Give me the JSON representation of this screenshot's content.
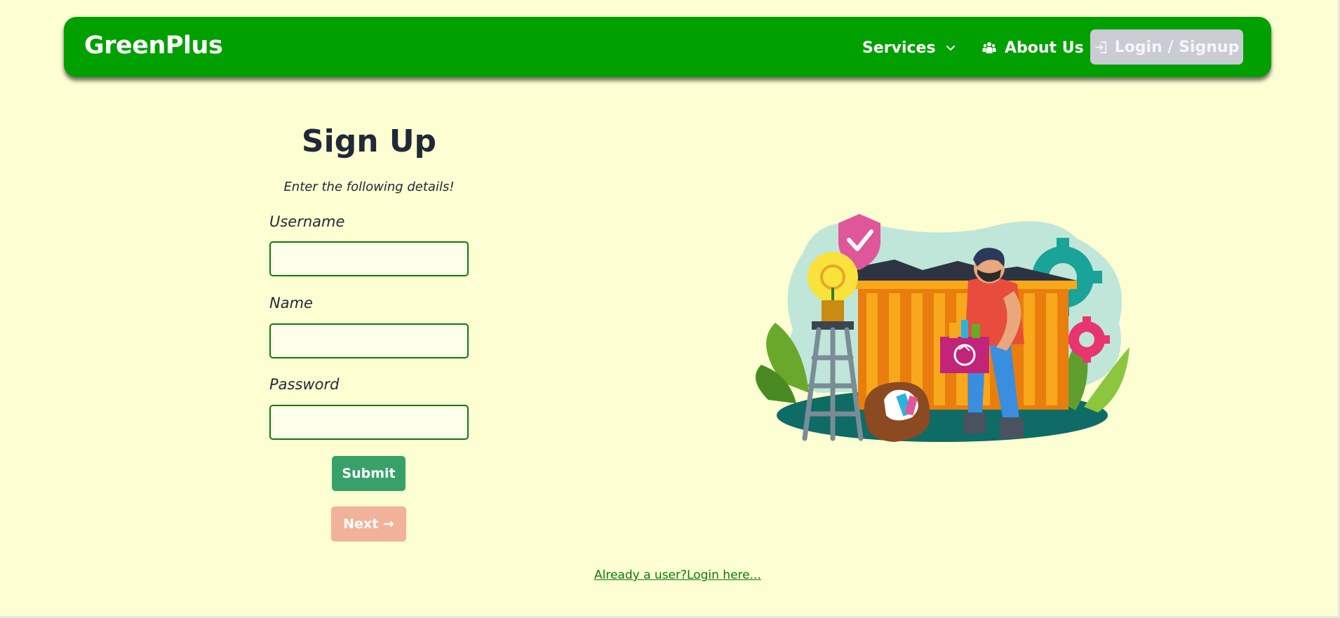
{
  "navbar": {
    "brand": "GreenPlus",
    "services_label": "Services",
    "about_label": "About Us",
    "login_label": "Login / Signup",
    "background_color": "#00a000"
  },
  "form": {
    "title": "Sign Up",
    "subtitle": "Enter the following details!",
    "fields": [
      {
        "label": "Username",
        "value": "",
        "placeholder": ""
      },
      {
        "label": "Name",
        "value": "",
        "placeholder": ""
      },
      {
        "label": "Password",
        "value": "",
        "placeholder": ""
      }
    ],
    "submit_label": "Submit",
    "next_label": "Next →"
  },
  "footer": {
    "login_link": "Already a user?Login here..."
  },
  "illustration": {
    "icon": "recycling-worker-illustration"
  },
  "colors": {
    "page_background": "#fdfed2",
    "submit": "#38a169",
    "next": "#f2b29a",
    "link": "#0b7a0b"
  }
}
